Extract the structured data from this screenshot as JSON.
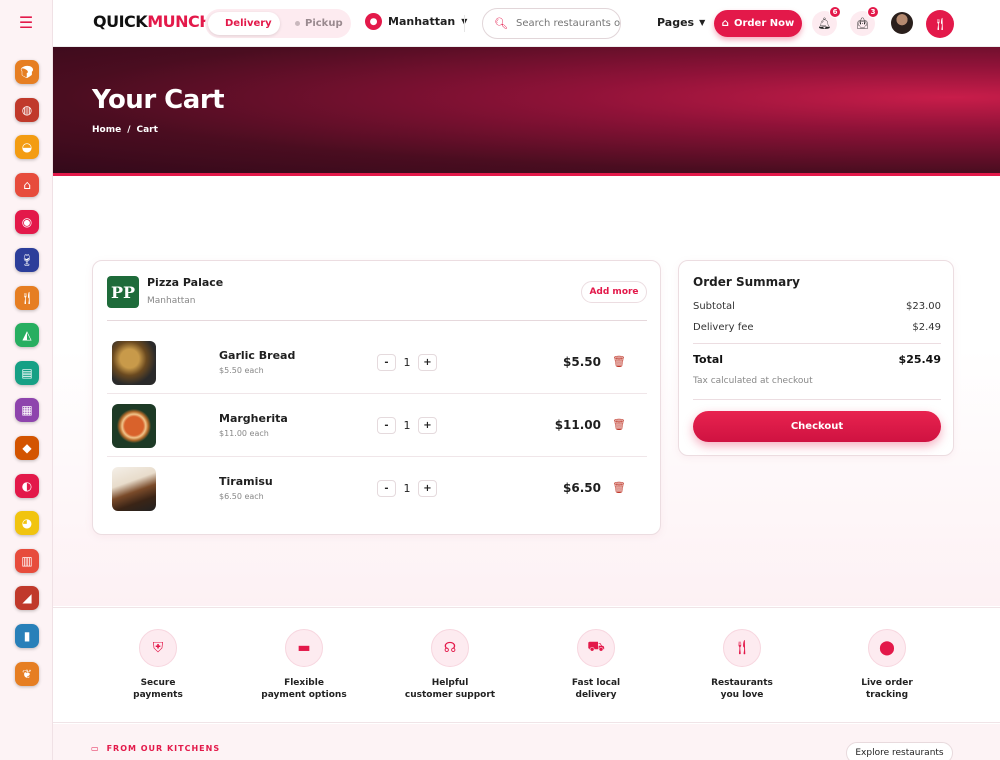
{
  "brand": {
    "name_part1": "QUICK",
    "name_part2": "MUNCH.",
    "accent_color": "#e3194a"
  },
  "rail": {
    "menu_icon": "hamburger-icon",
    "categories": [
      {
        "icon": "bread-icon",
        "color": "#e67e22"
      },
      {
        "icon": "donut-icon",
        "color": "#c0392b"
      },
      {
        "icon": "bowl-icon",
        "color": "#f39c12"
      },
      {
        "icon": "cupcake-icon",
        "color": "#e74c3c"
      },
      {
        "icon": "plate-icon",
        "color": "#e3194a"
      },
      {
        "icon": "wine-icon",
        "color": "#2c3e9a"
      },
      {
        "icon": "fork-knife-icon",
        "color": "#e67e22"
      },
      {
        "icon": "pizza-slice-icon",
        "color": "#27ae60"
      },
      {
        "icon": "sandwich-icon",
        "color": "#16a085"
      },
      {
        "icon": "burger-icon",
        "color": "#8e44ad"
      },
      {
        "icon": "meat-icon",
        "color": "#d35400"
      },
      {
        "icon": "shrimp-icon",
        "color": "#e3194a"
      },
      {
        "icon": "drumstick-icon",
        "color": "#f1c40f"
      },
      {
        "icon": "menu-card-icon",
        "color": "#e74c3c"
      },
      {
        "icon": "cheese-icon",
        "color": "#c0392b"
      },
      {
        "icon": "drink-icon",
        "color": "#2980b9"
      },
      {
        "icon": "leaf-icon",
        "color": "#e67e22"
      }
    ]
  },
  "header": {
    "mode_options": [
      "Delivery",
      "Pickup"
    ],
    "selected_mode": "Delivery",
    "location": "Manhattan",
    "search_placeholder": "Search restaurants or dishes",
    "pages_label": "Pages",
    "order_now_label": "Order Now",
    "notifications_count": "6",
    "cart_count": "3"
  },
  "hero": {
    "title": "Your Cart",
    "breadcrumb": [
      "Home",
      "/",
      "Cart"
    ]
  },
  "cart": {
    "restaurant": {
      "logo_text": "PP",
      "name": "Pizza Palace",
      "location": "Manhattan"
    },
    "add_more_label": "Add more",
    "items": [
      {
        "name": "Garlic Bread",
        "unit_price": "$5.50 each",
        "quantity": "1",
        "total": "$5.50",
        "minus": "-",
        "plus": "+"
      },
      {
        "name": "Margherita",
        "unit_price": "$11.00 each",
        "quantity": "1",
        "total": "$11.00",
        "minus": "-",
        "plus": "+"
      },
      {
        "name": "Tiramisu",
        "unit_price": "$6.50 each",
        "quantity": "1",
        "total": "$6.50",
        "minus": "-",
        "plus": "+"
      }
    ]
  },
  "summary": {
    "title": "Order Summary",
    "subtotal_label": "Subtotal",
    "subtotal_value": "$23.00",
    "delivery_label": "Delivery fee",
    "delivery_value": "$2.49",
    "total_label": "Total",
    "total_value": "$25.49",
    "tax_note": "Tax calculated at checkout",
    "checkout_label": "Checkout"
  },
  "features": [
    {
      "icon": "shield-icon",
      "label": "Secure\npayments"
    },
    {
      "icon": "wallet-icon",
      "label": "Flexible\npayment options"
    },
    {
      "icon": "headset-icon",
      "label": "Helpful\ncustomer support"
    },
    {
      "icon": "truck-icon",
      "label": "Fast local\ndelivery"
    },
    {
      "icon": "fork-knife-icon",
      "label": "Restaurants\nyou love"
    },
    {
      "icon": "location-pin-icon",
      "label": "Live order\ntracking"
    }
  ],
  "kitchens": {
    "title": "FROM OUR KITCHENS",
    "explore_label": "Explore restaurants"
  }
}
